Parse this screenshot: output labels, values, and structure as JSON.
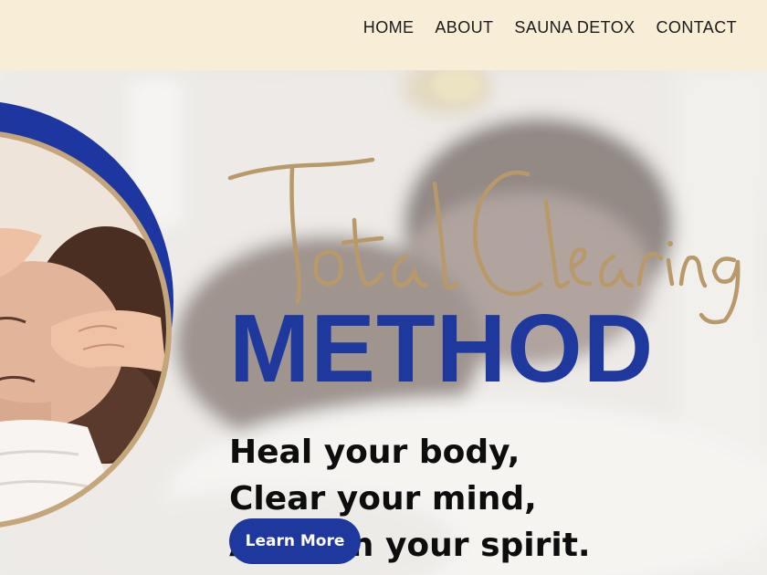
{
  "nav": {
    "items": [
      {
        "label": "HOME"
      },
      {
        "label": "ABOUT"
      },
      {
        "label": "SAUNA DETOX"
      },
      {
        "label": "CONTACT"
      }
    ]
  },
  "hero": {
    "script_title": "Total Clearing",
    "method_title": "METHOD",
    "tagline_lines": [
      "Heal your body,",
      "Clear your mind,",
      "Awaken your spirit."
    ],
    "cta_label": "Learn More"
  },
  "colors": {
    "brand_blue": "#1f389e",
    "brand_gold": "#c4a67a",
    "header_bg": "#f8eed8"
  }
}
